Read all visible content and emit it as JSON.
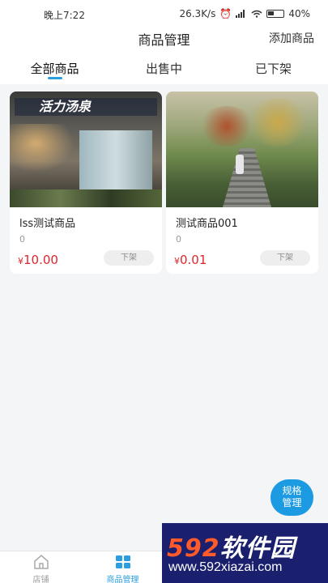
{
  "status_bar": {
    "time": "晚上7:22",
    "network_speed": "26.3K/s",
    "battery": "40"
  },
  "header": {
    "title": "商品管理",
    "add_button": "添加商品"
  },
  "tabs": [
    {
      "label": "全部商品",
      "active": true
    },
    {
      "label": "出售中",
      "active": false
    },
    {
      "label": "已下架",
      "active": false
    }
  ],
  "products": [
    {
      "name": "lss测试商品",
      "sold": "0",
      "currency": "¥",
      "price": "10.00",
      "action": "下架",
      "image_sign": "活力汤泉"
    },
    {
      "name": "测试商品001",
      "sold": "0",
      "currency": "¥",
      "price": "0.01",
      "action": "下架"
    }
  ],
  "fab": {
    "line1": "规格",
    "line2": "管理"
  },
  "tabbar": [
    {
      "label": "店铺",
      "icon": "home-icon",
      "active": false
    },
    {
      "label": "商品管理",
      "icon": "grid-icon",
      "active": true
    }
  ],
  "watermark": {
    "brand_num": "592",
    "brand_text": "软件园",
    "url": "www.592xiazai.com"
  },
  "colors": {
    "accent": "#2a9fe0",
    "price": "#e0262c",
    "fab": "#1d9be2"
  }
}
